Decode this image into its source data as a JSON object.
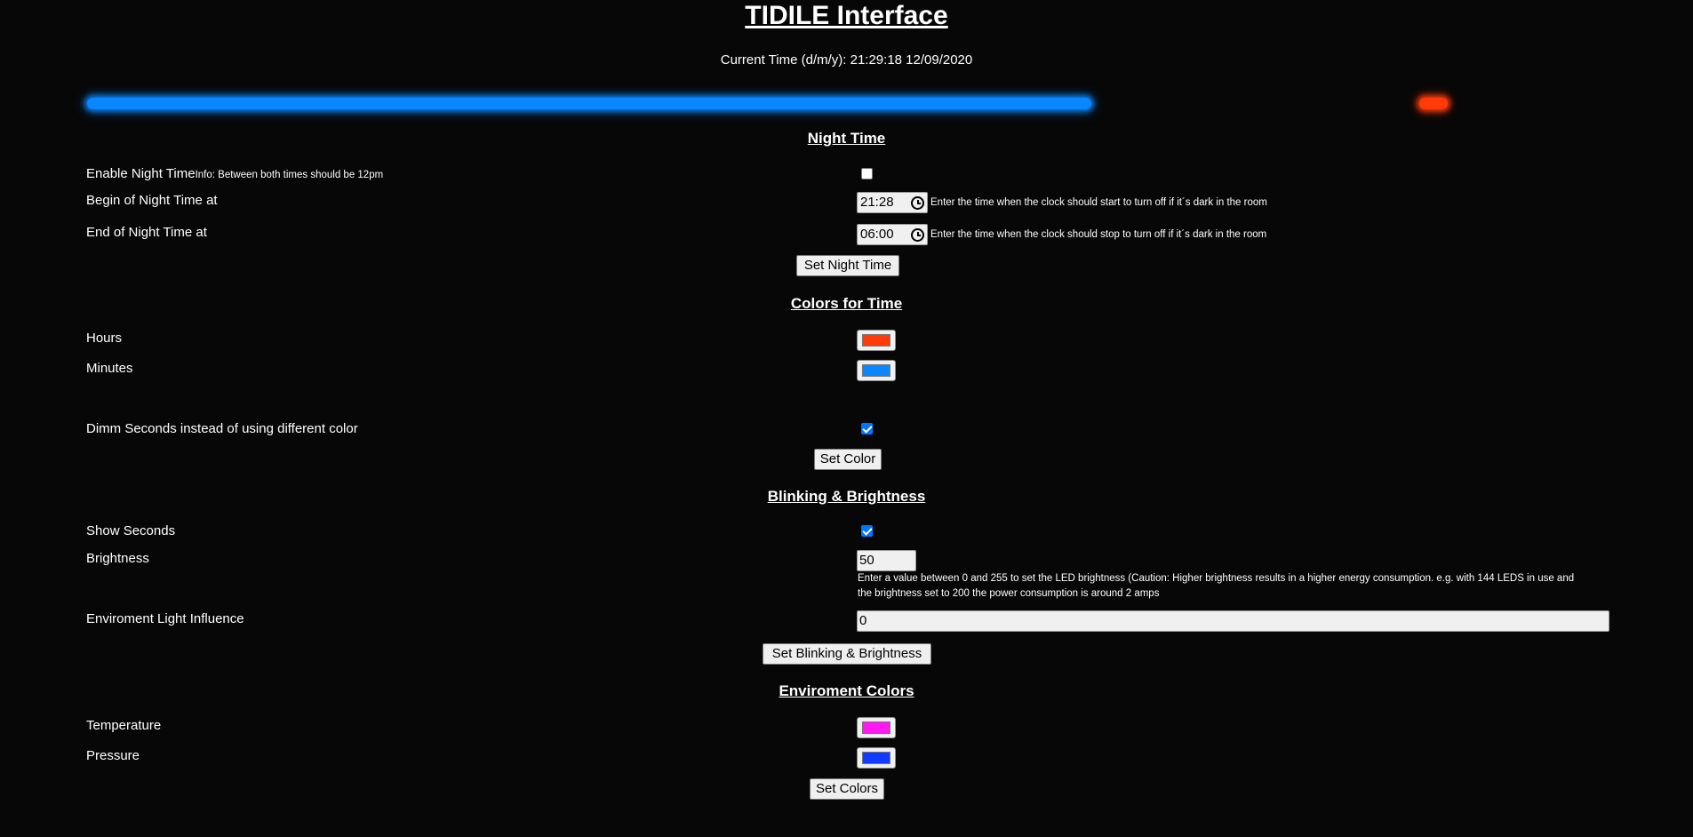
{
  "header": {
    "title": "TIDILE Interface",
    "current_time_label": "Current Time (d/m/y):",
    "current_time_value": "21:29:18 12/09/2020"
  },
  "preview": {
    "bar_color": "#0a86ff",
    "dot_color": "#ff3b0a"
  },
  "night_time": {
    "heading": "Night Time",
    "enable_label": "Enable Night Time",
    "enable_info": "Info: Between both times should be 12pm",
    "enabled": false,
    "begin_label": "Begin of Night Time at",
    "begin_value": "21:28",
    "begin_hint": "Enter the time when the clock should start to turn off if it´s dark in the room",
    "end_label": "End of Night Time at",
    "end_value": "06:00",
    "end_hint": "Enter the time when the clock should stop to turn off if it´s dark in the room",
    "button": "Set Night Time"
  },
  "colors_for_time": {
    "heading": "Colors for Time",
    "hours_label": "Hours",
    "hours_color": "#ff3b0a",
    "minutes_label": "Minutes",
    "minutes_color": "#0a86ff",
    "dimm_label": "Dimm Seconds instead of using different color",
    "dimm_checked": true,
    "button": "Set Color"
  },
  "blinking": {
    "heading": "Blinking & Brightness",
    "show_seconds_label": "Show Seconds",
    "show_seconds_checked": true,
    "brightness_label": "Brightness",
    "brightness_value": "50",
    "brightness_hint_line1": "Enter a value between 0 and 255 to set the LED brightness (Caution: Higher brightness results in a higher energy consumption. e.g. with 144 LEDS in use and",
    "brightness_hint_line2": "the brightness set to 200 the power consumption is around 2 amps",
    "env_light_label": "Enviroment Light Influence",
    "env_light_value": "0",
    "button": "Set Blinking & Brightness"
  },
  "environment_colors": {
    "heading": "Enviroment Colors",
    "temperature_label": "Temperature",
    "temperature_color": "#ff18f0",
    "pressure_label": "Pressure",
    "pressure_color": "#0f3cff",
    "button": "Set Colors"
  }
}
